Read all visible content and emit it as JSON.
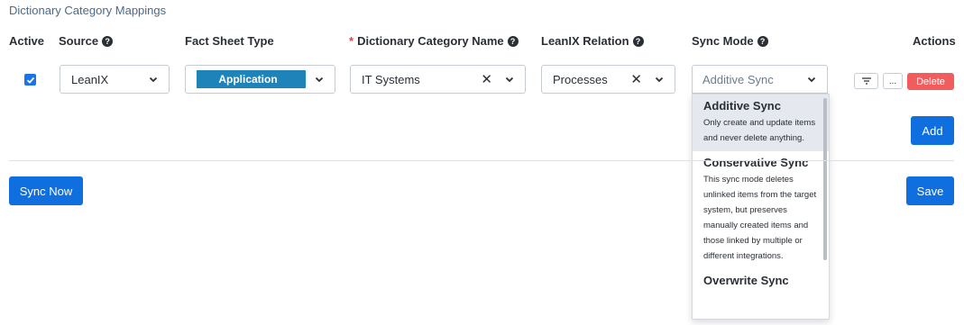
{
  "section": {
    "title": "Dictionary Category Mappings"
  },
  "table": {
    "headers": {
      "active": "Active",
      "source": "Source",
      "fact_sheet_type": "Fact Sheet Type",
      "dictionary_category_name": "Dictionary Category Name",
      "dictionary_required_marker": "*",
      "leanix_relation": "LeanIX Relation",
      "sync_mode": "Sync Mode",
      "actions": "Actions"
    },
    "row": {
      "active_checked": true,
      "source": "LeanIX",
      "fact_sheet_type": "Application",
      "dictionary_category": "IT Systems",
      "leanix_relation": "Processes",
      "sync_mode_placeholder": "Additive Sync",
      "more_label": "...",
      "delete_label": "Delete"
    }
  },
  "sync_dropdown": {
    "options": [
      {
        "title": "Additive Sync",
        "description": "Only create and update items and never delete anything."
      },
      {
        "title": "Conservative Sync",
        "description": "This sync mode deletes unlinked items from the target system, but preserves manually created items and those linked by multiple or different integrations."
      },
      {
        "title": "Overwrite Sync",
        "description": ""
      }
    ]
  },
  "buttons": {
    "add": "Add",
    "sync_now": "Sync Now",
    "save": "Save"
  },
  "colors": {
    "primary": "#0f6fdf",
    "danger": "#f25c5c",
    "fact_sheet_application": "#1e83b8"
  }
}
